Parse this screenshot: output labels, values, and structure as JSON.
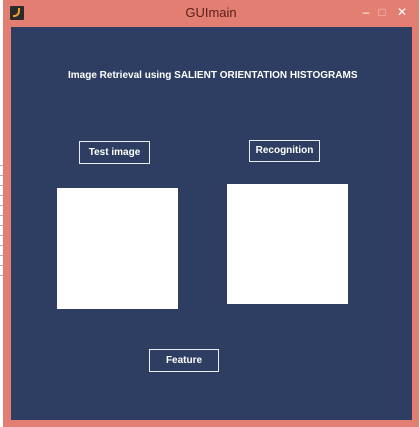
{
  "window": {
    "title": "GUImain",
    "controls": {
      "minimize": "–",
      "maximize": "□",
      "close": "✕"
    }
  },
  "panel": {
    "heading": "Image Retrieval using SALIENT ORIENTATION HISTOGRAMS",
    "buttons": {
      "test_image": "Test image",
      "recognition": "Recognition",
      "feature": "Feature"
    }
  },
  "colors": {
    "titlebar": "#e37e72",
    "background": "#2d3e62",
    "text": "#ffffff",
    "axes": "#ffffff"
  },
  "icons": {
    "app": "matlab-icon"
  }
}
